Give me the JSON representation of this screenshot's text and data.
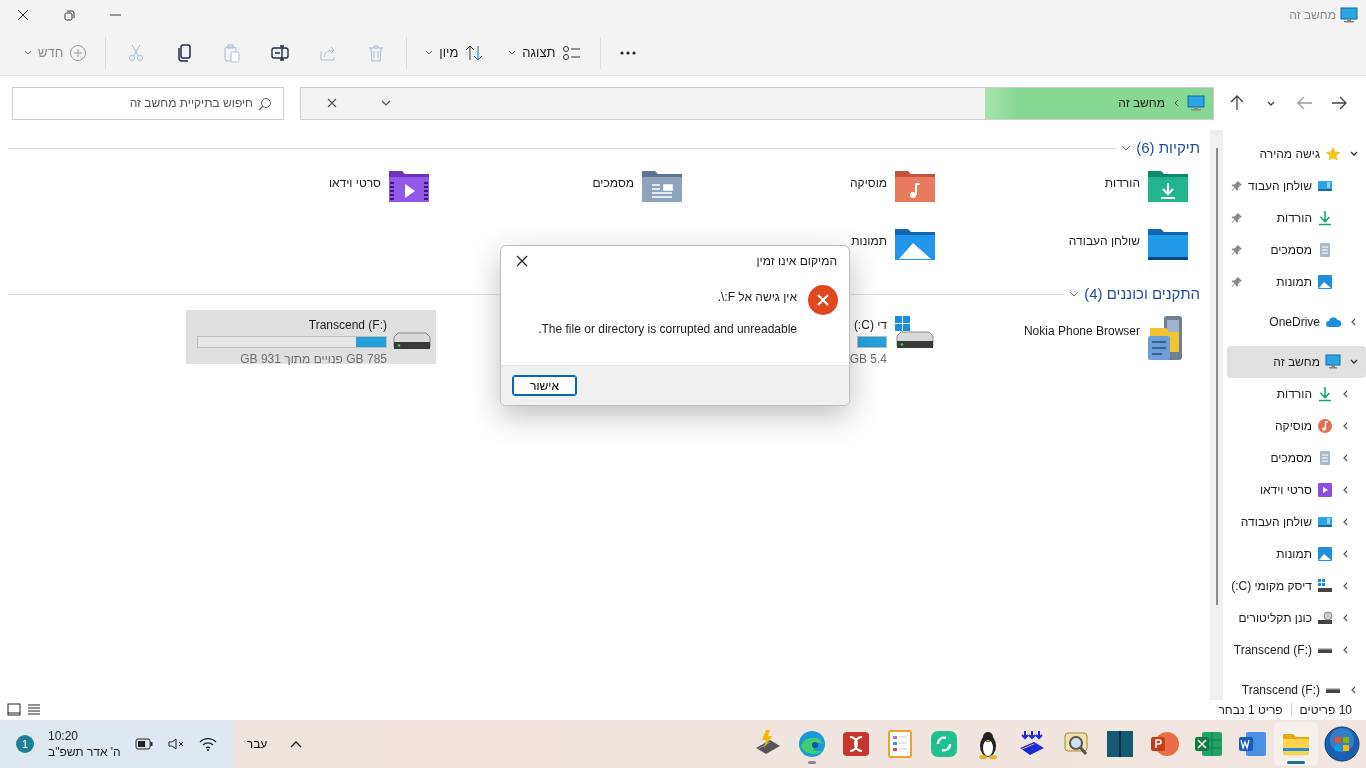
{
  "window": {
    "title": "מחשב זה"
  },
  "toolbar": {
    "new": {
      "label": "חדש",
      "disabled": true
    },
    "actions": [
      {
        "kind": "cut",
        "disabled": true
      },
      {
        "kind": "copy",
        "disabled": false
      },
      {
        "kind": "paste",
        "disabled": true
      },
      {
        "kind": "rename",
        "disabled": false
      },
      {
        "kind": "share",
        "disabled": true
      },
      {
        "kind": "delete",
        "disabled": true
      }
    ],
    "sort": {
      "label": "מיון"
    },
    "view": {
      "label": "תצוגה"
    }
  },
  "navigation": [
    {
      "kind": "back",
      "disabled": false
    },
    {
      "kind": "forward",
      "disabled": true
    },
    {
      "kind": "recent",
      "disabled": false
    },
    {
      "kind": "up",
      "disabled": false
    }
  ],
  "address": {
    "path": [
      "מחשב זה"
    ],
    "level": 0.25
  },
  "search": {
    "placeholder": "חיפוש בתיקיית מחשב זה"
  },
  "sections": [
    {
      "title": "תיקיות (6)",
      "expanded": true,
      "items": [
        {
          "kind": "downloads",
          "label": "הורדות"
        },
        {
          "kind": "music",
          "label": "מוסיקה"
        },
        {
          "kind": "documents",
          "label": "מסמכים"
        },
        {
          "kind": "videos",
          "label": "סרטי וידאו"
        },
        {
          "kind": "desktop",
          "label": "שולחן העבודה"
        },
        {
          "kind": "pictures",
          "label": "תמונות"
        }
      ]
    },
    {
      "title": "התקנים וכוננים (4)",
      "expanded": true,
      "items": [
        {
          "kind": "phone",
          "label": "Nokia Phone Browser",
          "selected": false
        },
        {
          "kind": "system-drive",
          "label": "די (C:)",
          "free": "5.4 GB",
          "selected": false
        },
        {
          "kind": "usb-drive",
          "label": "Transcend (F:)",
          "free": "785 GB פנויים מתוך 931 GB",
          "level": 0.16,
          "selected": true
        }
      ]
    }
  ],
  "sidebar": {
    "items": [
      {
        "label": "גישה מהירה",
        "kind": "star",
        "expanded": true,
        "selected": false,
        "children": [
          {
            "label": "שולחן העבוד",
            "kind": "desktop",
            "pinned": true,
            "selected": false
          },
          {
            "label": "הורדות",
            "kind": "downloads",
            "pinned": true,
            "selected": false
          },
          {
            "label": "מסמכים",
            "kind": "documents",
            "pinned": true,
            "selected": false
          },
          {
            "label": "תמונות",
            "kind": "pictures",
            "pinned": true,
            "selected": false
          }
        ]
      },
      {
        "label": "OneDrive",
        "kind": "cloud",
        "expanded": false,
        "selected": false
      },
      {
        "label": "מחשב זה",
        "kind": "computer",
        "expanded": true,
        "selected": true,
        "children": [
          {
            "label": "הורדות",
            "kind": "downloads",
            "expanded": false,
            "selected": false
          },
          {
            "label": "מוסיקה",
            "kind": "music",
            "expanded": false,
            "selected": false
          },
          {
            "label": "מסמכים",
            "kind": "documents",
            "expanded": false,
            "selected": false
          },
          {
            "label": "סרטי וידאו",
            "kind": "videos",
            "expanded": false,
            "selected": false
          },
          {
            "label": "שולחן העבודה",
            "kind": "desktop",
            "expanded": false,
            "selected": false
          },
          {
            "label": "תמונות",
            "kind": "pictures",
            "expanded": false,
            "selected": false
          },
          {
            "label": "דיסק מקומי (C:)",
            "kind": "system-drive",
            "expanded": false,
            "selected": false
          },
          {
            "label": "כונן תקליטורים",
            "kind": "cd-drive",
            "expanded": false,
            "selected": false
          },
          {
            "label": "Transcend (F:)",
            "kind": "usb-drive",
            "expanded": false,
            "selected": false
          }
        ]
      },
      {
        "label": "Transcend (F:)",
        "kind": "usb-drive",
        "expanded": false,
        "selected": false
      }
    ]
  },
  "status_bar": {
    "count": "10 פריטים",
    "selection": "פריט 1 נבחר",
    "views": [
      {
        "kind": "tiles",
        "selected": false
      },
      {
        "kind": "details",
        "selected": false
      }
    ]
  },
  "dialog": {
    "title": "המיקום אינו זמין",
    "lines": [
      "אין גישה אל F:\\.",
      "The file or directory is corrupted and unreadable."
    ],
    "button": "אישור"
  },
  "taskbar": {
    "apps": [
      {
        "kind": "start",
        "running": false,
        "selected": false
      },
      {
        "kind": "explorer",
        "running": true,
        "selected": true
      },
      {
        "kind": "word",
        "running": false,
        "selected": false
      },
      {
        "kind": "excel",
        "running": false,
        "selected": false
      },
      {
        "kind": "powerpoint",
        "running": false,
        "selected": false
      },
      {
        "kind": "book",
        "running": false,
        "selected": false
      },
      {
        "kind": "scroll",
        "running": false,
        "selected": false
      },
      {
        "kind": "chip",
        "running": false,
        "selected": false
      },
      {
        "kind": "penguin",
        "running": false,
        "selected": false
      },
      {
        "kind": "ring",
        "running": false,
        "selected": false
      },
      {
        "kind": "checklist",
        "running": false,
        "selected": false
      },
      {
        "kind": "red-app",
        "running": false,
        "selected": false
      },
      {
        "kind": "edge",
        "running": true,
        "selected": false
      },
      {
        "kind": "bolt-chip",
        "running": false,
        "selected": false
      }
    ],
    "language": "עבר",
    "time": "10:20",
    "date": "ה' אדר תשפ\"ב",
    "notifications": "1"
  }
}
